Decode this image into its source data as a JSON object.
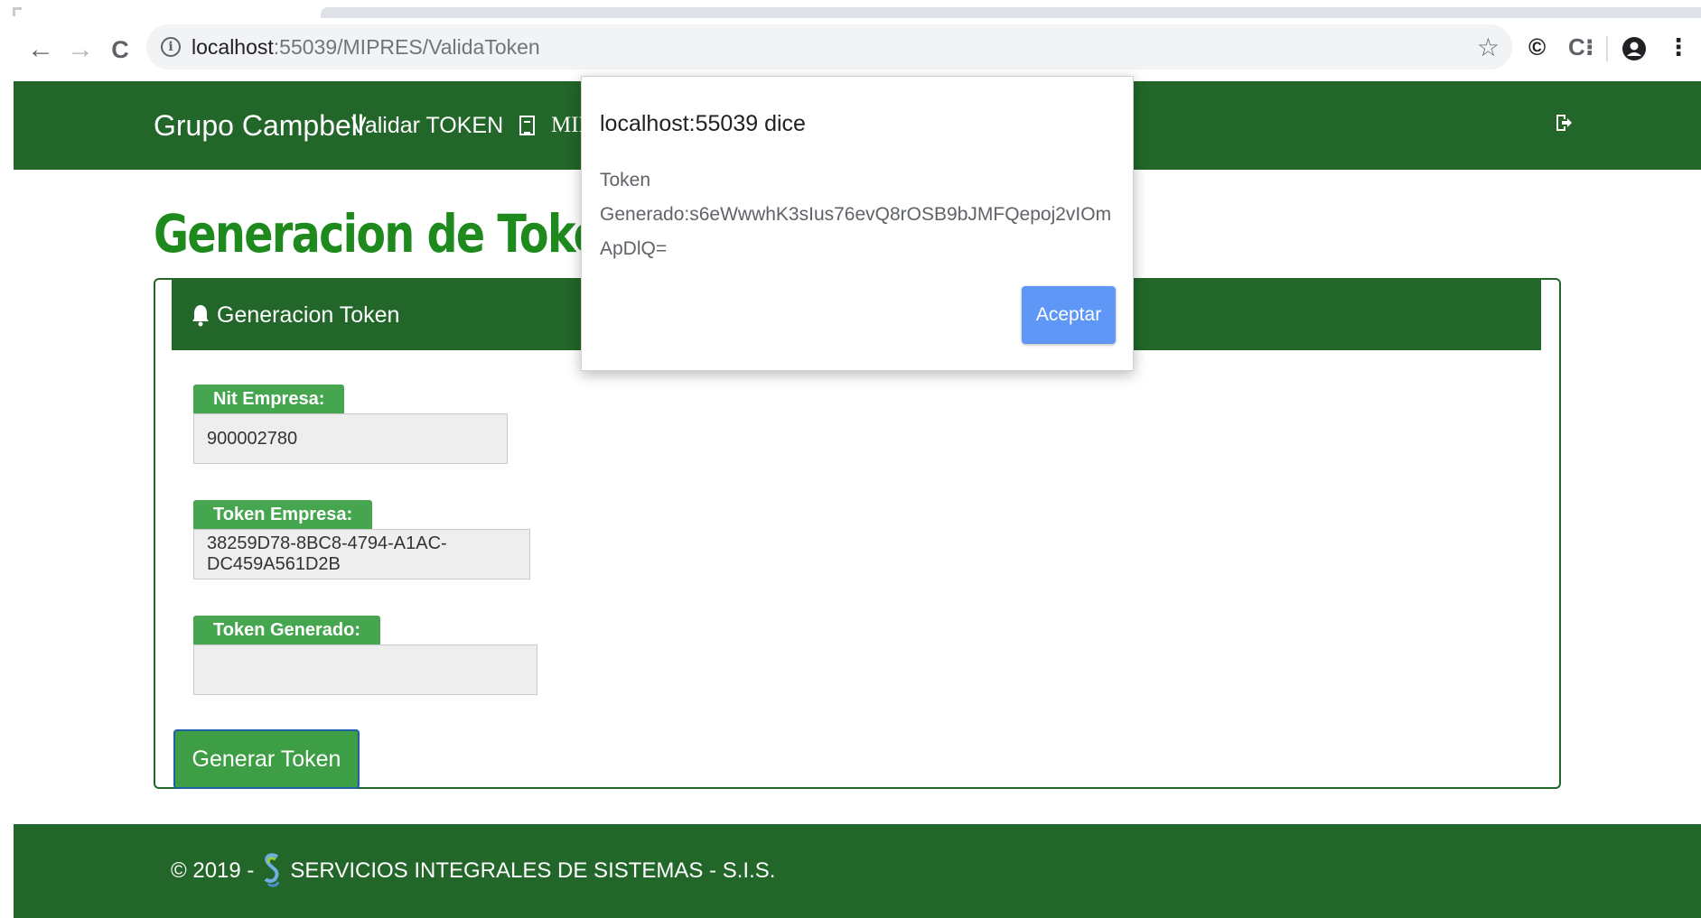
{
  "browser": {
    "url_host": "localhost",
    "url_path": ":55039/MIPRES/ValidaToken",
    "back_icon": "←",
    "forward_icon": "→",
    "reload_icon": "C",
    "info_icon": "i",
    "star_icon": "☆",
    "ext1_icon": "©",
    "ext2_icon": "C⁝",
    "menu_icon": "⋮"
  },
  "navbar": {
    "brand": "Grupo Campbell",
    "links": [
      "Validar TOKEN",
      "MIPR"
    ]
  },
  "page": {
    "title": "Generacion de Token"
  },
  "panel": {
    "header": "Generacion Token",
    "fields": [
      {
        "label": "Nit Empresa:",
        "value": "900002780"
      },
      {
        "label": "Token Empresa:",
        "value": "38259D78-8BC8-4794-A1AC-DC459A561D2B"
      },
      {
        "label": "Token Generado:",
        "value": ""
      }
    ],
    "button": "Generar Token"
  },
  "footer": {
    "prefix": "© 2019 -",
    "company": "SERVICIOS INTEGRALES DE SISTEMAS - S.I.S."
  },
  "dialog": {
    "title": "localhost:55039 dice",
    "message_line1": "Token",
    "message_line2": "Generado:s6eWwwhK3sIus76evQ8rOSB9bJMFQepoj2vIOmApDlQ=",
    "ok": "Aceptar"
  },
  "colors": {
    "brand_green": "#226629",
    "label_green": "#46a64f",
    "title_green": "#1e8a1e",
    "dialog_button": "#5e97f6"
  }
}
